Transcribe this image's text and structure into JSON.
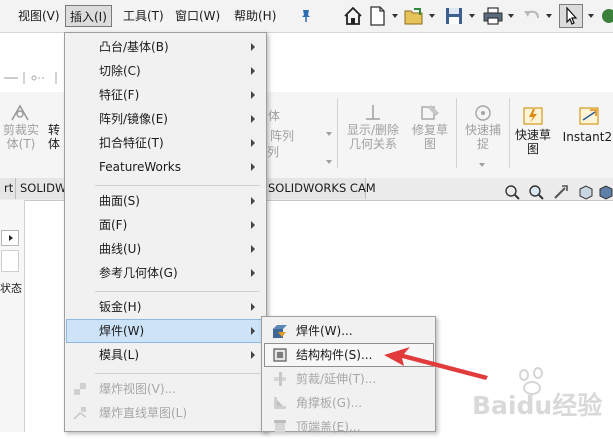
{
  "menubar": {
    "items": [
      "视图(V)",
      "插入(I)",
      "工具(T)",
      "窗口(W)",
      "帮助(H)"
    ],
    "active_index": 1
  },
  "quick_access": {
    "icons": [
      "home-icon",
      "new-document-icon",
      "open-folder-icon",
      "save-icon",
      "print-icon",
      "undo-icon",
      "select-cursor-icon",
      "options-icon"
    ]
  },
  "ribbon": {
    "left_labels": [
      "剪裁实\n体(T)",
      "转\n体"
    ],
    "partial_labels": [
      "体",
      "阵列",
      "列"
    ],
    "buttons": [
      {
        "label": "显示/删除\n几何关系",
        "enabled": false
      },
      {
        "label": "修复草\n图",
        "enabled": false
      },
      {
        "label": "快速捕\n捉",
        "enabled": false
      },
      {
        "label": "快速草\n图",
        "enabled": true
      },
      {
        "label": "Instant2D",
        "enabled": true
      }
    ]
  },
  "tabs": [
    "rt",
    "SOLIDW",
    "SOLIDWORKS CAM"
  ],
  "left_panel": {
    "text": "状态"
  },
  "insert_menu": {
    "groups": [
      [
        {
          "label": "凸台/基体(B)",
          "submenu": true
        },
        {
          "label": "切除(C)",
          "submenu": true
        },
        {
          "label": "特征(F)",
          "submenu": true
        },
        {
          "label": "阵列/镜像(E)",
          "submenu": true
        },
        {
          "label": "扣合特征(T)",
          "submenu": true
        },
        {
          "label": "FeatureWorks",
          "submenu": true
        }
      ],
      [
        {
          "label": "曲面(S)",
          "submenu": true
        },
        {
          "label": "面(F)",
          "submenu": true
        },
        {
          "label": "曲线(U)",
          "submenu": true
        },
        {
          "label": "参考几何体(G)",
          "submenu": true
        }
      ],
      [
        {
          "label": "钣金(H)",
          "submenu": true
        },
        {
          "label": "焊件(W)",
          "submenu": true,
          "selected": true
        },
        {
          "label": "模具(L)",
          "submenu": true
        }
      ],
      [
        {
          "label": "爆炸视图(V)...",
          "submenu": false,
          "disabled": true
        },
        {
          "label": "爆炸直线草图(L)",
          "submenu": false,
          "disabled": true
        }
      ]
    ]
  },
  "weldment_submenu": {
    "items": [
      {
        "label": "焊件(W)...",
        "icon": "weldment-icon",
        "disabled": false
      },
      {
        "label": "结构构件(S)...",
        "icon": "structural-member-icon",
        "disabled": false,
        "highlighted": true
      },
      {
        "label": "剪裁/延伸(T)...",
        "icon": "trim-extend-icon",
        "disabled": true
      },
      {
        "label": "角撑板(G)...",
        "icon": "gusset-icon",
        "disabled": true
      },
      {
        "label": "顶端盖(E)...",
        "icon": "end-cap-icon",
        "disabled": true
      }
    ]
  },
  "annotation": {
    "color": "#e23b3b"
  },
  "watermark": {
    "text": "Baidu经验"
  }
}
